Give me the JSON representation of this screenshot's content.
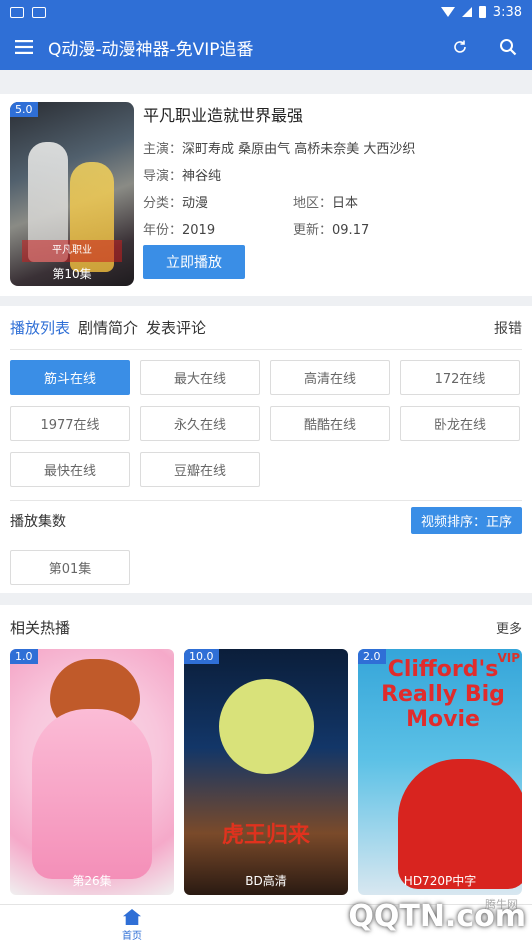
{
  "statusbar": {
    "time": "3:38"
  },
  "appbar": {
    "title": "Q动漫-动漫神器-免VIP追番"
  },
  "detail": {
    "title": "平凡职业造就世界最强",
    "rating": "5.0",
    "episode": "第10集",
    "cast_label": "主演：",
    "cast_value": "深町寿成 桑原由气 高桥未奈美 大西沙织",
    "director_label": "导演：",
    "director_value": "神谷纯",
    "category_label": "分类：",
    "category_value": "动漫",
    "region_label": "地区：",
    "region_value": "日本",
    "year_label": "年份：",
    "year_value": "2019",
    "update_label": "更新：",
    "update_value": "09.17",
    "play_label": "立即播放",
    "poster_text": "平凡职业"
  },
  "tabs": {
    "items": [
      "播放列表",
      "剧情简介",
      "发表评论"
    ],
    "report": "报错"
  },
  "sources": [
    "筋斗在线",
    "最大在线",
    "高清在线",
    "172在线",
    "1977在线",
    "永久在线",
    "酷酷在线",
    "卧龙在线",
    "最快在线",
    "豆瓣在线"
  ],
  "episodes": {
    "heading": "播放集数",
    "sort_label": "视频排序：正序",
    "items": [
      "第01集"
    ]
  },
  "hot": {
    "heading": "相关热播",
    "more": "更多",
    "items": [
      {
        "rating": "1.0",
        "label": "第26集"
      },
      {
        "rating": "10.0",
        "label": "BD高清",
        "poster_text": "虎王归来"
      },
      {
        "rating": "2.0",
        "label": "HD720P中字",
        "poster_text": "Clifford's Really Big Movie",
        "badge": "VIP"
      }
    ]
  },
  "bottom_nav": {
    "home": "首页"
  },
  "watermark": {
    "brand": "QQTN.com",
    "sub": "腾牛网"
  },
  "colors": {
    "primary": "#2f6fd6",
    "button": "#3a8ee6"
  }
}
